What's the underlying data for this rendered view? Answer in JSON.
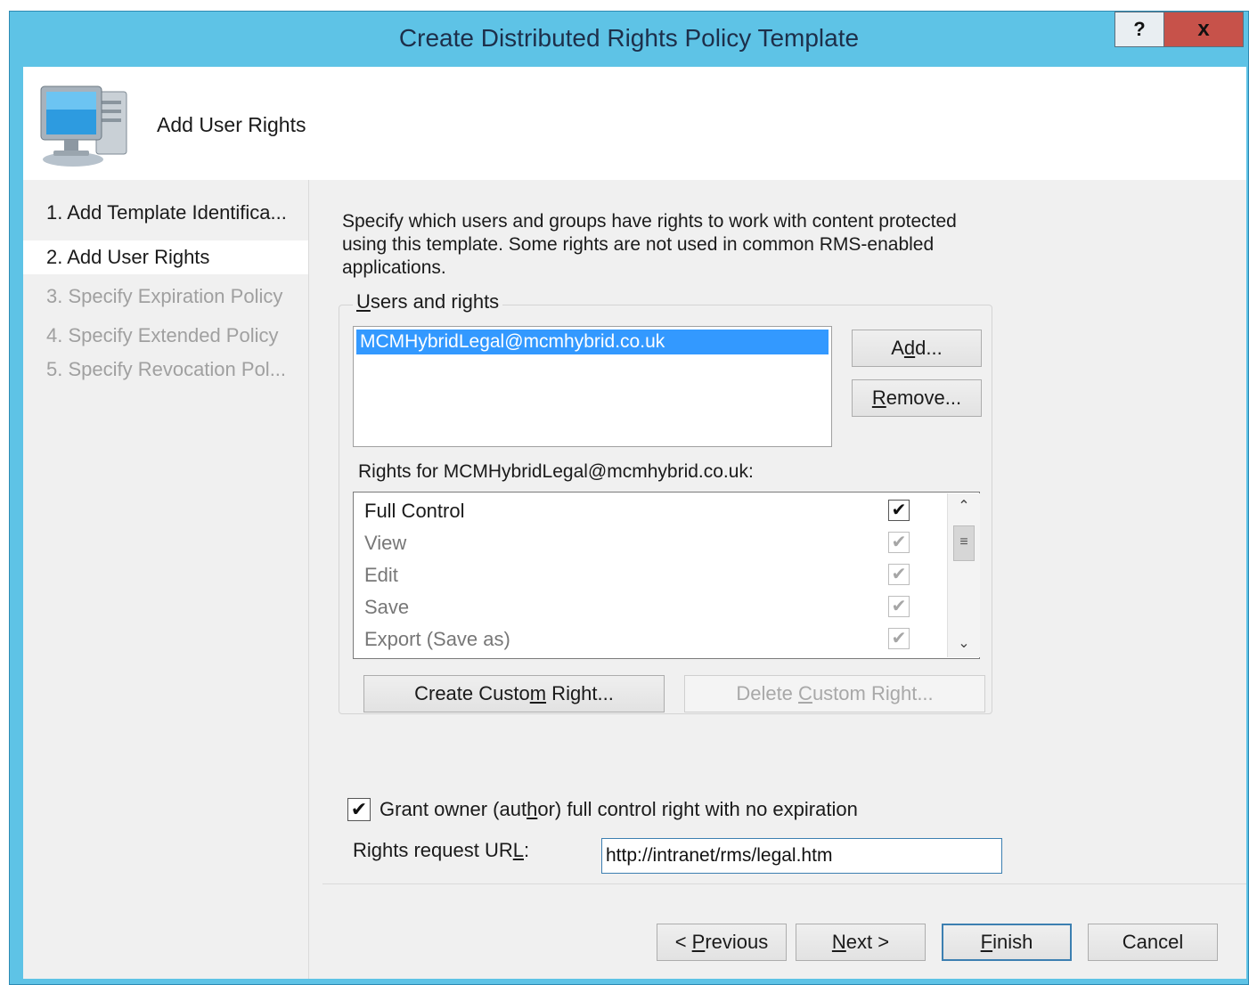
{
  "window": {
    "title": "Create Distributed Rights Policy Template",
    "help_label": "?",
    "close_label": "x"
  },
  "header": {
    "title": "Add User Rights",
    "icon": "computer-icon"
  },
  "nav": {
    "items": [
      {
        "label": "1. Add Template Identifica...",
        "state": "enabled"
      },
      {
        "label": "2. Add User Rights",
        "state": "active"
      },
      {
        "label": "3. Specify Expiration Policy",
        "state": "disabled"
      },
      {
        "label": "4. Specify Extended Policy",
        "state": "disabled"
      },
      {
        "label": "5. Specify Revocation Pol...",
        "state": "disabled"
      }
    ]
  },
  "content": {
    "description": "Specify which users and groups have rights to work with content protected using this template. Some rights are not used in common RMS-enabled applications.",
    "users_group": {
      "label_access_key": "U",
      "label_rest": "sers and rights",
      "users": [
        "MCMHybridLegal@mcmhybrid.co.uk"
      ],
      "add_button": {
        "pre": "A",
        "key": "d",
        "post": "d..."
      },
      "remove_button": {
        "pre": "",
        "key": "R",
        "post": "emove..."
      }
    },
    "rights_label": "Rights for MCMHybridLegal@mcmhybrid.co.uk:",
    "rights": [
      {
        "name": "Full Control",
        "checked": true,
        "inherited": false
      },
      {
        "name": "View",
        "checked": true,
        "inherited": true
      },
      {
        "name": "Edit",
        "checked": true,
        "inherited": true
      },
      {
        "name": "Save",
        "checked": true,
        "inherited": true
      },
      {
        "name": "Export (Save as)",
        "checked": true,
        "inherited": true
      }
    ],
    "create_custom": {
      "pre": "Create Custo",
      "key": "m",
      "post": " Right..."
    },
    "delete_custom": {
      "pre": "Delete ",
      "key": "C",
      "post": "ustom Right..."
    },
    "owner_checkbox": {
      "checked": true,
      "pre": "Grant owner (aut",
      "key": "h",
      "post": "or) full control right with no expiration"
    },
    "url": {
      "label_pre": "Rights request UR",
      "label_key": "L",
      "label_post": ":",
      "value": "http://intranet/rms/legal.htm"
    }
  },
  "footer": {
    "previous": {
      "pre": "< ",
      "key": "P",
      "post": "revious"
    },
    "next": {
      "pre": "",
      "key": "N",
      "post": "ext >"
    },
    "finish": {
      "pre": "",
      "key": "F",
      "post": "inish"
    },
    "cancel": "Cancel"
  },
  "glyphs": {
    "check": "✔",
    "scroll_up": "⌃",
    "scroll_down": "⌄",
    "scroll_grip": "≡"
  },
  "colors": {
    "title_bar": "#5ec3e6",
    "close_button": "#c7524a",
    "selection": "#3399ff",
    "dialog_bg": "#f0f0f0"
  }
}
